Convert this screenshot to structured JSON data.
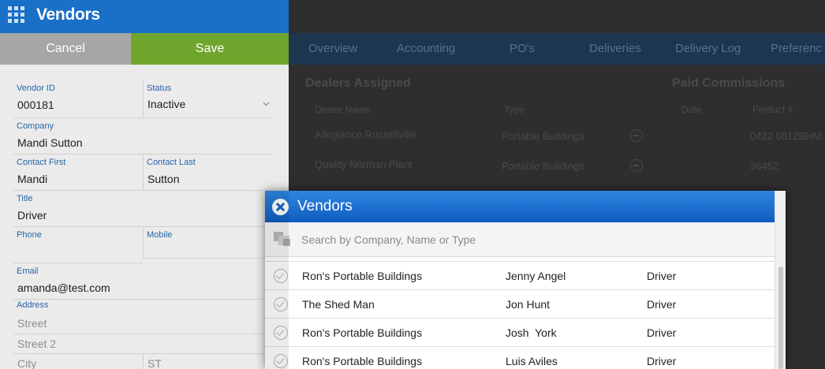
{
  "app": {
    "title": "Vendors"
  },
  "actions": {
    "cancel_label": "Cancel",
    "save_label": "Save"
  },
  "form": {
    "vendor_id": {
      "label": "Vendor ID",
      "value": "000181"
    },
    "status": {
      "label": "Status",
      "value": "Inactive"
    },
    "company": {
      "label": "Company",
      "value": "Mandi Sutton"
    },
    "contact_first": {
      "label": "Contact First",
      "value": "Mandi"
    },
    "contact_last": {
      "label": "Contact Last",
      "value": "Sutton"
    },
    "title": {
      "label": "Title",
      "value": "Driver"
    },
    "phone": {
      "label": "Phone",
      "value": ""
    },
    "mobile": {
      "label": "Mobile",
      "value": ""
    },
    "email": {
      "label": "Email",
      "value": "amanda@test.com"
    },
    "address": {
      "label": "Address",
      "street_placeholder": "Street",
      "street2_placeholder": "Street 2",
      "city_placeholder": "City",
      "state_placeholder": "ST"
    }
  },
  "tabs": [
    "Overview",
    "Accounting",
    "PO's",
    "Deliveries",
    "Delivery Log",
    "Preferenc"
  ],
  "dealers": {
    "heading": "Dealers Assigned",
    "columns": [
      "Dealer Name",
      "Type"
    ],
    "rows": [
      {
        "name": "Allegiance Russellville",
        "type": "Portable Buildings"
      },
      {
        "name": "Quality Norman Plant",
        "type": "Portable Buildings"
      }
    ]
  },
  "commissions": {
    "heading": "Paid Commissions",
    "columns": [
      "Date",
      "Product #"
    ],
    "rows": [
      {
        "date": "",
        "product": "0422 0812BHM"
      },
      {
        "date": "",
        "product": "36452"
      }
    ]
  },
  "modal": {
    "title": "Vendors",
    "search_placeholder": "Search by Company, Name or Type",
    "rows": [
      {
        "company": "Ron's Portable Buildings",
        "name": "Jenny Angel",
        "type": "Driver"
      },
      {
        "company": "The Shed Man",
        "name": "Jon Hunt",
        "type": "Driver"
      },
      {
        "company": "Ron's Portable Buildings",
        "name": "Josh  York",
        "type": "Driver"
      },
      {
        "company": "Ron's Portable Buildings",
        "name": "Luis Aviles",
        "type": "Driver"
      }
    ]
  },
  "colors": {
    "header_blue": "#1a6fc6",
    "save_green": "#6fa52c",
    "cancel_gray": "#a6a6a6",
    "label_blue": "#2a6fb8"
  },
  "icons": {
    "apps": "grid-icon",
    "close": "close-circle-icon",
    "copy": "copy-icon",
    "row_check": "check-circle-icon",
    "remove": "minus-circle-icon",
    "status_dropdown": "chevron-down-icon"
  }
}
